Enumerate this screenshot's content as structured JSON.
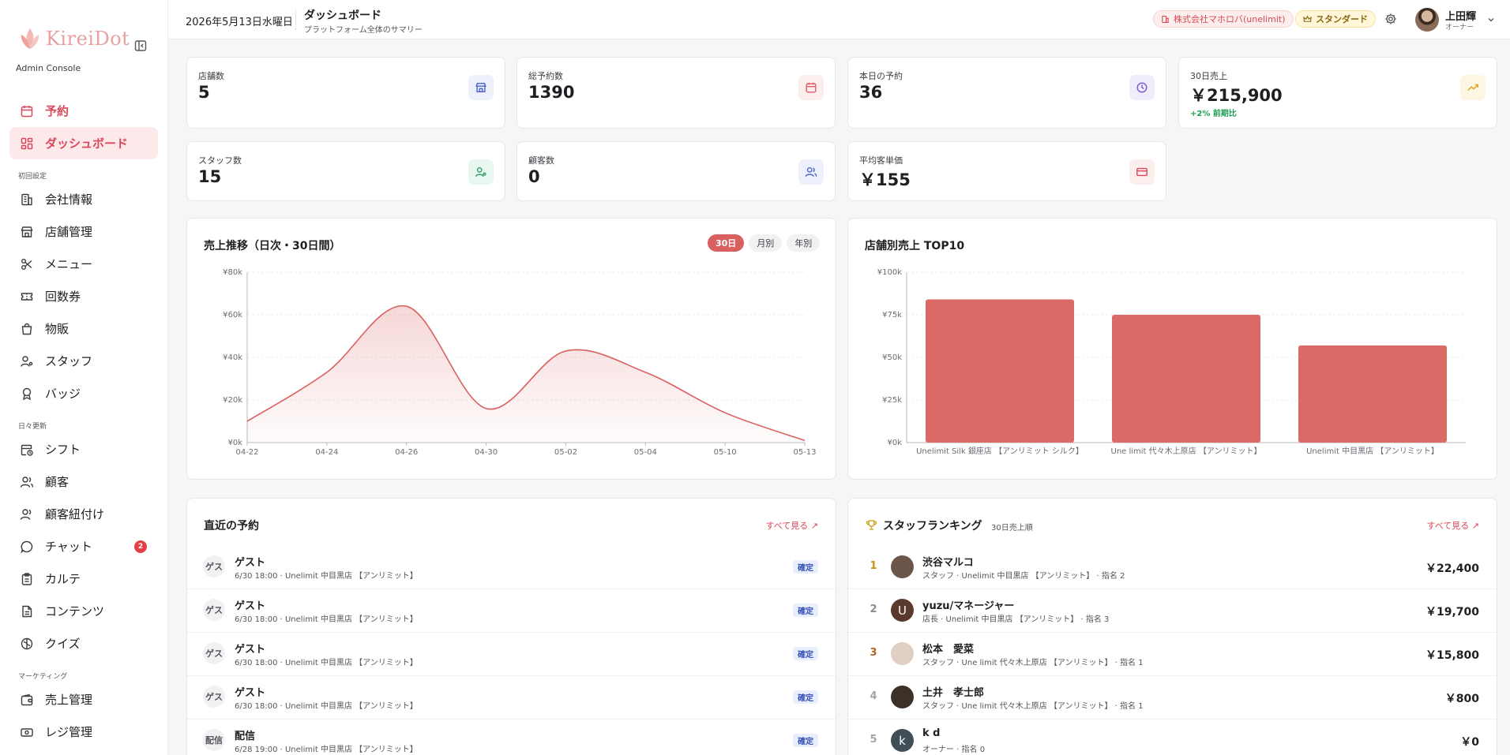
{
  "brand": {
    "name": "KireiDot",
    "subtitle": "Admin Console"
  },
  "sidebar": {
    "items_top": [
      {
        "label": "予約",
        "icon": "calendar-icon"
      },
      {
        "label": "ダッシュボード",
        "icon": "grid-icon"
      }
    ],
    "sections": [
      {
        "title": "初回設定",
        "items": [
          {
            "label": "会社情報",
            "icon": "building-icon"
          },
          {
            "label": "店舗管理",
            "icon": "store-icon"
          },
          {
            "label": "メニュー",
            "icon": "scissors-icon"
          },
          {
            "label": "回数券",
            "icon": "ticket-icon"
          },
          {
            "label": "物販",
            "icon": "bag-icon"
          },
          {
            "label": "スタッフ",
            "icon": "user-gear-icon"
          },
          {
            "label": "バッジ",
            "icon": "badge-icon"
          }
        ]
      },
      {
        "title": "日々更新",
        "items": [
          {
            "label": "シフト",
            "icon": "calendar-clock-icon"
          },
          {
            "label": "顧客",
            "icon": "users-icon"
          },
          {
            "label": "顧客紐付け",
            "icon": "users-link-icon"
          },
          {
            "label": "チャット",
            "icon": "chat-icon",
            "badge": "2"
          },
          {
            "label": "カルテ",
            "icon": "clipboard-icon"
          },
          {
            "label": "コンテンツ",
            "icon": "document-icon"
          },
          {
            "label": "クイズ",
            "icon": "brain-icon"
          }
        ]
      },
      {
        "title": "マーケティング",
        "items": [
          {
            "label": "売上管理",
            "icon": "wallet-icon"
          },
          {
            "label": "レジ管理",
            "icon": "cash-icon"
          }
        ]
      }
    ]
  },
  "header": {
    "date": "2026年5月13日水曜日",
    "title": "ダッシュボード",
    "subtitle": "プラットフォーム全体のサマリー",
    "company": "株式会社マホロバ(unelimit)",
    "plan": "スタンダード",
    "user_name": "上田輝",
    "user_role": "オーナー"
  },
  "stats": [
    {
      "label": "店舗数",
      "value": "5",
      "icon": "store-icon",
      "color": "#4a63c9",
      "bg": "#eef1fc"
    },
    {
      "label": "総予約数",
      "value": "1390",
      "icon": "calendar-icon",
      "color": "#e0616a",
      "bg": "#fdeeee"
    },
    {
      "label": "本日の予約",
      "value": "36",
      "icon": "clock-icon",
      "color": "#7b55d6",
      "bg": "#f1ecfc"
    },
    {
      "label": "30日売上",
      "value": "￥215,900",
      "sub": "+2% 前期比",
      "icon": "trend-up-icon",
      "color": "#d9a325",
      "bg": "#fdf6e3"
    },
    {
      "label": "スタッフ数",
      "value": "15",
      "icon": "user-gear-icon",
      "color": "#2f9d67",
      "bg": "#e8f7ef"
    },
    {
      "label": "顧客数",
      "value": "0",
      "icon": "users-icon",
      "color": "#4a63c9",
      "bg": "#eef1fc"
    },
    {
      "label": "平均客単価",
      "value": "￥155",
      "icon": "card-icon",
      "color": "#d8485a",
      "bg": "#fdeeee"
    }
  ],
  "sales_trend": {
    "title": "売上推移（日次・30日間）",
    "tabs": [
      "30日",
      "月別",
      "年別"
    ],
    "active_tab": "30日"
  },
  "store_top": {
    "title": "店舗別売上 TOP10"
  },
  "chart_data": [
    {
      "type": "area",
      "title": "売上推移（日次・30日間）",
      "x": [
        "04-22",
        "04-24",
        "04-26",
        "04-30",
        "05-02",
        "05-04",
        "05-10",
        "05-13"
      ],
      "values": [
        10000,
        33000,
        64000,
        16000,
        43000,
        33000,
        14000,
        1000
      ],
      "ylim": [
        0,
        80000
      ],
      "yticks": [
        "¥0k",
        "¥20k",
        "¥40k",
        "¥60k",
        "¥80k"
      ],
      "grid": true,
      "color": "#d9605e"
    },
    {
      "type": "bar",
      "title": "店舗別売上 TOP10",
      "categories": [
        "Unelimit Silk 銀座店 【アンリミット シルク】",
        "Une limit 代々木上原店 【アンリミット】",
        "Unelimit 中目黒店 【アンリミット】"
      ],
      "values": [
        84000,
        75000,
        57000
      ],
      "ylim": [
        0,
        100000
      ],
      "yticks": [
        "¥0k",
        "¥25k",
        "¥50k",
        "¥75k",
        "¥100k"
      ],
      "grid": true,
      "color": "#d96a66"
    }
  ],
  "recent": {
    "title": "直近の予約",
    "see_all": "すべて見る ↗",
    "rows": [
      {
        "avatar": "ゲス",
        "name": "ゲスト",
        "meta": "6/30 18:00 · Unelimit 中目黒店 【アンリミット】",
        "status": "確定"
      },
      {
        "avatar": "ゲス",
        "name": "ゲスト",
        "meta": "6/30 18:00 · Unelimit 中目黒店 【アンリミット】",
        "status": "確定"
      },
      {
        "avatar": "ゲス",
        "name": "ゲスト",
        "meta": "6/30 18:00 · Unelimit 中目黒店 【アンリミット】",
        "status": "確定"
      },
      {
        "avatar": "ゲス",
        "name": "ゲスト",
        "meta": "6/30 18:00 · Unelimit 中目黒店 【アンリミット】",
        "status": "確定"
      },
      {
        "avatar": "配信",
        "name": "配信",
        "meta": "6/28 19:00 · Unelimit 中目黒店 【アンリミット】",
        "status": "確定"
      }
    ]
  },
  "ranking": {
    "title": "スタッフランキング",
    "subtitle": "30日売上順",
    "see_all": "すべて見る ↗",
    "rows": [
      {
        "rank": "1",
        "rank_color": "#c99414",
        "avatar": "",
        "avatar_bg": "#6b5548",
        "name": "渋谷マルコ",
        "meta": "スタッフ · Unelimit 中目黒店 【アンリミット】 · 指名 2",
        "amount": "￥22,400"
      },
      {
        "rank": "2",
        "rank_color": "#8c8c94",
        "avatar": "U",
        "avatar_bg": "#5a3a2c",
        "name": "yuzu/マネージャー",
        "meta": "店長 · Unelimit 中目黒店 【アンリミット】 · 指名 3",
        "amount": "￥19,700"
      },
      {
        "rank": "3",
        "rank_color": "#b0651d",
        "avatar": "",
        "avatar_bg": "#e0cfc2",
        "name": "松本　愛菜",
        "meta": "スタッフ · Une limit 代々木上原店 【アンリミット】 · 指名 1",
        "amount": "￥15,800"
      },
      {
        "rank": "4",
        "rank_color": "#a3a3ab",
        "avatar": "",
        "avatar_bg": "#3c3029",
        "name": "土井　孝士郎",
        "meta": "スタッフ · Une limit 代々木上原店 【アンリミット】 · 指名 1",
        "amount": "￥800"
      },
      {
        "rank": "5",
        "rank_color": "#a3a3ab",
        "avatar": "k",
        "avatar_bg": "#3f4e57",
        "name": "k d",
        "meta": "オーナー · 指名 0",
        "amount": "￥0"
      }
    ]
  }
}
